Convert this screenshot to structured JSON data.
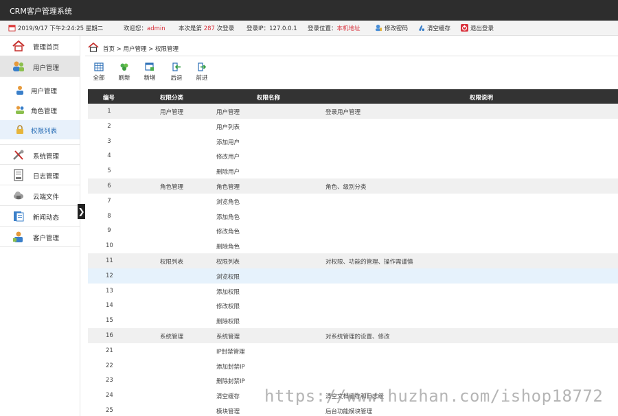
{
  "app": {
    "title": "CRM客户管理系统"
  },
  "infobar": {
    "datetime": "2019/9/17 下午2:24:25 星期二",
    "welcome_prefix": "欢迎您：",
    "username": "admin",
    "login_count_prefix": "本次是第",
    "login_count": "287",
    "login_count_suffix": "次登录",
    "login_ip": "登录IP：127.0.0.1",
    "location_prefix": "登录位置：",
    "location": "本机地址",
    "change_password": "修改密码",
    "clear_cache": "清空缓存",
    "logout": "退出登录"
  },
  "sidebar": {
    "home": "管理首页",
    "user_mgmt": "用户管理",
    "sub": [
      "用户管理",
      "角色管理",
      "权限列表"
    ],
    "items": [
      "系统管理",
      "日志管理",
      "云端文件",
      "新闻动态",
      "客户管理"
    ],
    "toggle": "❯"
  },
  "breadcrumb": "首页 > 用户管理 > 权限管理",
  "toolbar": [
    "全部",
    "刷新",
    "新增",
    "后退",
    "前进"
  ],
  "table": {
    "columns": [
      "编号",
      "权限分类",
      "权限名称",
      "权限说明"
    ],
    "rows": [
      [
        "1",
        "用户管理",
        "用户管理",
        "登录用户管理"
      ],
      [
        "2",
        "",
        "用户列表",
        ""
      ],
      [
        "3",
        "",
        "添加用户",
        ""
      ],
      [
        "4",
        "",
        "修改用户",
        ""
      ],
      [
        "5",
        "",
        "删除用户",
        ""
      ],
      [
        "6",
        "角色管理",
        "角色管理",
        "角色、级别分类"
      ],
      [
        "7",
        "",
        "浏览角色",
        ""
      ],
      [
        "8",
        "",
        "添加角色",
        ""
      ],
      [
        "9",
        "",
        "修改角色",
        ""
      ],
      [
        "10",
        "",
        "删除角色",
        ""
      ],
      [
        "11",
        "权限列表",
        "权限列表",
        "对权限、功能的管理、操作需谨慎"
      ],
      [
        "12",
        "",
        "浏览权限",
        ""
      ],
      [
        "13",
        "",
        "添加权限",
        ""
      ],
      [
        "14",
        "",
        "修改权限",
        ""
      ],
      [
        "15",
        "",
        "删除权限",
        ""
      ],
      [
        "16",
        "系统管理",
        "系统管理",
        "对系统管理的设置、修改"
      ],
      [
        "21",
        "",
        "IP封禁管理",
        ""
      ],
      [
        "22",
        "",
        "添加封禁IP",
        ""
      ],
      [
        "23",
        "",
        "删除封禁IP",
        ""
      ],
      [
        "24",
        "",
        "清空缓存",
        "清空文档缓存和日志缓"
      ],
      [
        "25",
        "",
        "模块管理",
        "后台功能模块管理"
      ]
    ]
  },
  "watermark": "https://www.huzhan.com/ishop18772",
  "colors": {
    "topbar": "#2d2d2d",
    "accent_red": "#d9303b",
    "active_blue": "#2b6fb6",
    "table_head": "#333333"
  }
}
